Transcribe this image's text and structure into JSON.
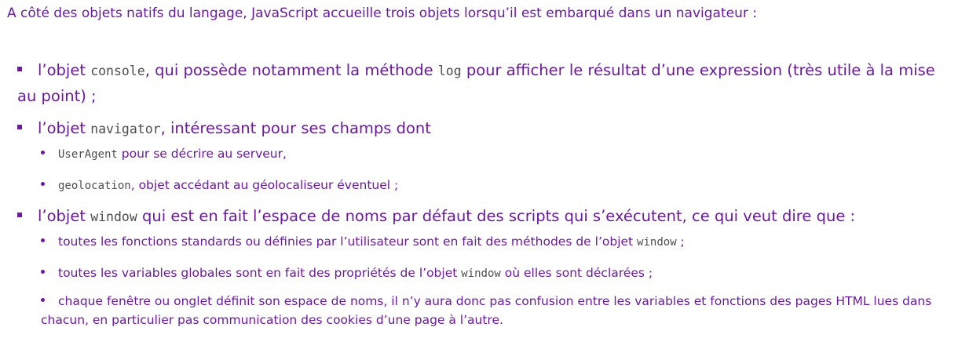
{
  "intro": "A côté des objets natifs du langage, JavaScript accueille trois objets lorsqu’il est embarqué dans un navigateur :",
  "items": [
    {
      "pre": "l’objet ",
      "code": "console",
      "post": ", qui possède notamment la méthode ",
      "code2": "log",
      "post2": " pour afficher le résultat d’une expression (très utile à la mise au point) ;"
    },
    {
      "pre": "l’objet ",
      "code": "navigator",
      "post": ", intéressant pour ses champs dont",
      "subitems": [
        {
          "code": "UserAgent",
          "post": " pour se décrire au serveur,"
        },
        {
          "code": "geolocation",
          "post": ", objet accédant au géolocaliseur éventuel ;"
        }
      ]
    },
    {
      "pre": "l’objet ",
      "code": "window",
      "post": " qui est en fait l’espace de noms par défaut des scripts qui s’exécutent, ce qui veut dire que :",
      "subitems": [
        {
          "pre": "toutes les fonctions standards ou définies par l’utilisateur sont en fait des méthodes de l’objet ",
          "code": "window",
          "post": " ;"
        },
        {
          "pre": "toutes les variables globales sont en fait des propriétés de l’objet ",
          "code": "window",
          "post": " où elles sont déclarées ;"
        },
        {
          "pre": "chaque fenêtre ou onglet définit son espace de noms, il n’y aura donc pas confusion entre les variables et fonctions des pages HTML lues dans chacun, en particulier pas communication des cookies d’une page à l’autre."
        }
      ]
    }
  ]
}
